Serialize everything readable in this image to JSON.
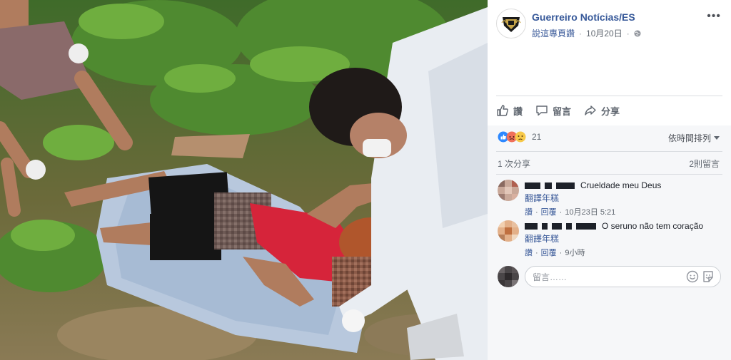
{
  "post": {
    "page_name": "Guerreiro Notícias/ES",
    "like_page": "說這專頁讚",
    "date": "10月20日",
    "privacy_icon": "globe-icon",
    "more_label": "•••"
  },
  "actions": {
    "like": "讚",
    "comment": "留言",
    "share": "分享"
  },
  "reactions": {
    "count": "21",
    "icons": [
      "like-icon",
      "angry-icon",
      "sad-icon"
    ]
  },
  "sort": {
    "label": "依時間排列"
  },
  "stats": {
    "shares": "1 次分享",
    "comments": "2則留言"
  },
  "comments": [
    {
      "text": "Crueldade meu Deus",
      "translate": "翻譯年糕",
      "like": "讚",
      "reply": "回覆",
      "time": "10月23日 5:21"
    },
    {
      "text": "O seruno não tem coração",
      "translate": "翻譯年糕",
      "like": "讚",
      "reply": "回覆",
      "time": "9小時"
    }
  ],
  "comment_input": {
    "placeholder": "留言……"
  }
}
